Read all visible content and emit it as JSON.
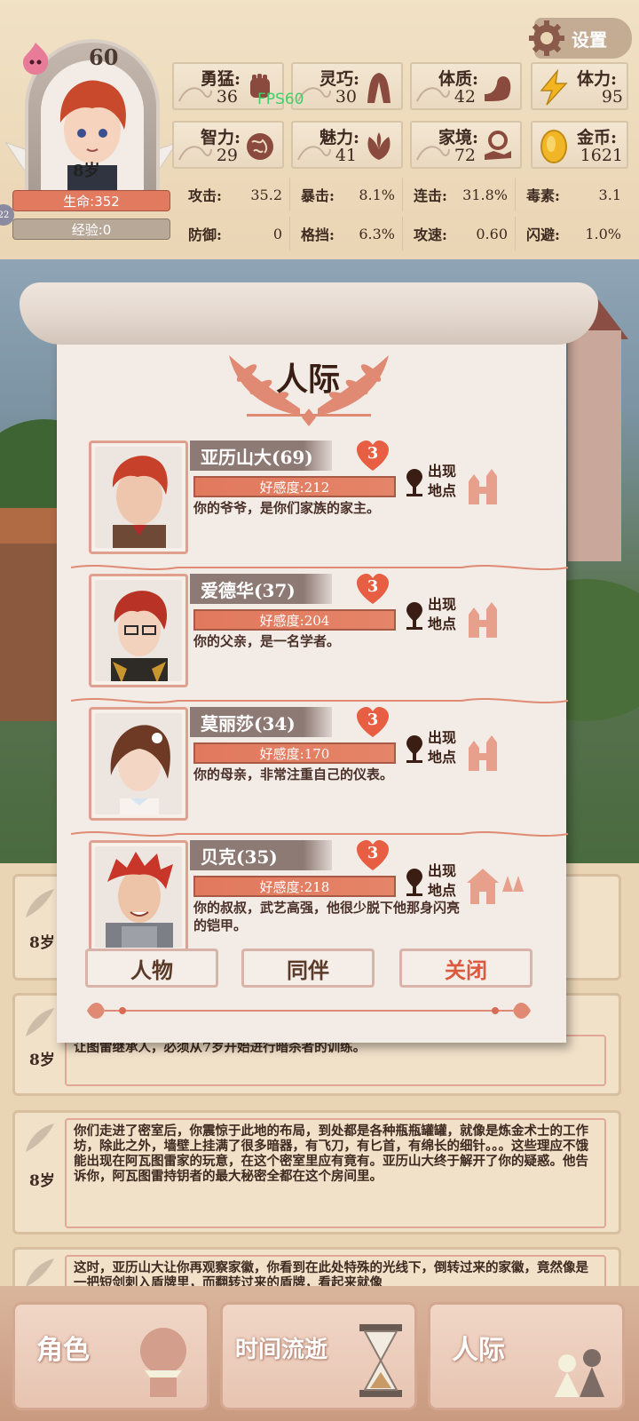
{
  "header": {
    "settings_label": "设置",
    "level": "60",
    "age": "8岁",
    "hp": "生命:352",
    "exp": "经验:0",
    "level_circle": "22",
    "fps": "FPS60"
  },
  "attributes": [
    {
      "label": "勇猛:",
      "value": "36",
      "icon": "fist-icon"
    },
    {
      "label": "灵巧:",
      "value": "30",
      "icon": "cloak-icon"
    },
    {
      "label": "体质:",
      "value": "42",
      "icon": "muscle-arm-icon"
    },
    {
      "label": "智力:",
      "value": "29",
      "icon": "brain-icon"
    },
    {
      "label": "魅力:",
      "value": "41",
      "icon": "flower-bud-icon"
    },
    {
      "label": "家境:",
      "value": "72",
      "icon": "coin-hand-icon"
    }
  ],
  "resources": [
    {
      "label": "体力:",
      "value": "95",
      "icon": "lightning-icon"
    },
    {
      "label": "金币:",
      "value": "1621",
      "icon": "gold-coin-icon"
    }
  ],
  "combat": [
    {
      "k": "攻击:",
      "v": "35.2"
    },
    {
      "k": "暴击:",
      "v": "8.1%"
    },
    {
      "k": "连击:",
      "v": "31.8%"
    },
    {
      "k": "毒素:",
      "v": "3.1"
    },
    {
      "k": "防御:",
      "v": "0"
    },
    {
      "k": "格挡:",
      "v": "6.3%"
    },
    {
      "k": "攻速:",
      "v": "0.60"
    },
    {
      "k": "闪避:",
      "v": "1.0%"
    }
  ],
  "modal": {
    "title": "人际",
    "people": [
      {
        "name": "亚历山大(69)",
        "heart": "3",
        "favor": "好感度:212",
        "desc": "你的爷爷，是你们家族的家主。",
        "loc": [
          "出现",
          "地点"
        ]
      },
      {
        "name": "爱德华(37)",
        "heart": "3",
        "favor": "好感度:204",
        "desc": "你的父亲，是一名学者。",
        "loc": [
          "出现",
          "地点"
        ]
      },
      {
        "name": "莫丽莎(34)",
        "heart": "3",
        "favor": "好感度:170",
        "desc": "你的母亲，非常注重自己的仪表。",
        "loc": [
          "出现",
          "地点"
        ]
      },
      {
        "name": "贝克(35)",
        "heart": "3",
        "favor": "好感度:218",
        "desc": "你的叔叔，武艺高强，他很少脱下他那身闪亮的铠甲。",
        "loc": [
          "出现",
          "地点"
        ]
      }
    ],
    "buttons": {
      "characters": "人物",
      "companions": "同伴",
      "close": "关闭"
    }
  },
  "log": [
    {
      "age": "8岁",
      "text": ""
    },
    {
      "age": "8岁",
      "text": "让图雷继承人，必须从7岁开始进行暗杀者的训练。"
    },
    {
      "age": "8岁",
      "text": "你们走进了密室后，你震惊于此地的布局，到处都是各种瓶瓶罐罐，就像是炼金术士的工作坊，除此之外，墙壁上挂满了很多暗器，有飞刀，有匕首，有绵长的细针。。。这些理应不饿能出现在阿瓦图雷家的玩意，在这个密室里应有竟有。亚历山大终于解开了你的疑惑。他告诉你，阿瓦图雷持钥者的最大秘密全都在这个房间里。"
    },
    {
      "age": "",
      "text": "这时，亚历山大让你再观察家徽，你看到在此处特殊的光线下，倒转过来的家徽，竟然像是一把短剑刺入盾牌里，而翻转过来的盾牌，看起来就像"
    }
  ],
  "nav": [
    {
      "label": "角色",
      "icon": "character-bust-icon"
    },
    {
      "label": "时间流逝",
      "icon": "hourglass-icon"
    },
    {
      "label": "人际",
      "icon": "people-pawns-icon"
    }
  ]
}
